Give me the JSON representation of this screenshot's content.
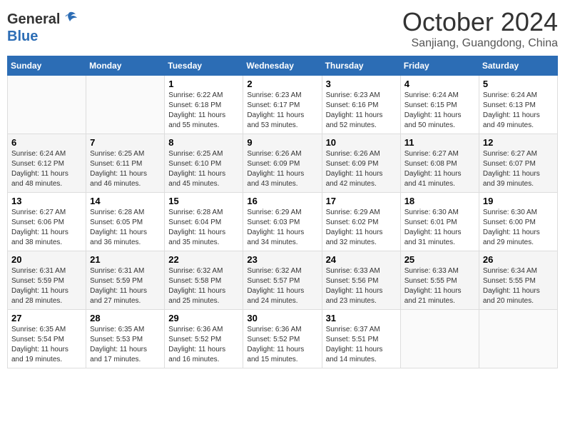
{
  "header": {
    "logo_general": "General",
    "logo_blue": "Blue",
    "month": "October 2024",
    "location": "Sanjiang, Guangdong, China"
  },
  "weekdays": [
    "Sunday",
    "Monday",
    "Tuesday",
    "Wednesday",
    "Thursday",
    "Friday",
    "Saturday"
  ],
  "weeks": [
    [
      {
        "day": "",
        "sunrise": "",
        "sunset": "",
        "daylight": ""
      },
      {
        "day": "",
        "sunrise": "",
        "sunset": "",
        "daylight": ""
      },
      {
        "day": "1",
        "sunrise": "Sunrise: 6:22 AM",
        "sunset": "Sunset: 6:18 PM",
        "daylight": "Daylight: 11 hours and 55 minutes."
      },
      {
        "day": "2",
        "sunrise": "Sunrise: 6:23 AM",
        "sunset": "Sunset: 6:17 PM",
        "daylight": "Daylight: 11 hours and 53 minutes."
      },
      {
        "day": "3",
        "sunrise": "Sunrise: 6:23 AM",
        "sunset": "Sunset: 6:16 PM",
        "daylight": "Daylight: 11 hours and 52 minutes."
      },
      {
        "day": "4",
        "sunrise": "Sunrise: 6:24 AM",
        "sunset": "Sunset: 6:15 PM",
        "daylight": "Daylight: 11 hours and 50 minutes."
      },
      {
        "day": "5",
        "sunrise": "Sunrise: 6:24 AM",
        "sunset": "Sunset: 6:13 PM",
        "daylight": "Daylight: 11 hours and 49 minutes."
      }
    ],
    [
      {
        "day": "6",
        "sunrise": "Sunrise: 6:24 AM",
        "sunset": "Sunset: 6:12 PM",
        "daylight": "Daylight: 11 hours and 48 minutes."
      },
      {
        "day": "7",
        "sunrise": "Sunrise: 6:25 AM",
        "sunset": "Sunset: 6:11 PM",
        "daylight": "Daylight: 11 hours and 46 minutes."
      },
      {
        "day": "8",
        "sunrise": "Sunrise: 6:25 AM",
        "sunset": "Sunset: 6:10 PM",
        "daylight": "Daylight: 11 hours and 45 minutes."
      },
      {
        "day": "9",
        "sunrise": "Sunrise: 6:26 AM",
        "sunset": "Sunset: 6:09 PM",
        "daylight": "Daylight: 11 hours and 43 minutes."
      },
      {
        "day": "10",
        "sunrise": "Sunrise: 6:26 AM",
        "sunset": "Sunset: 6:09 PM",
        "daylight": "Daylight: 11 hours and 42 minutes."
      },
      {
        "day": "11",
        "sunrise": "Sunrise: 6:27 AM",
        "sunset": "Sunset: 6:08 PM",
        "daylight": "Daylight: 11 hours and 41 minutes."
      },
      {
        "day": "12",
        "sunrise": "Sunrise: 6:27 AM",
        "sunset": "Sunset: 6:07 PM",
        "daylight": "Daylight: 11 hours and 39 minutes."
      }
    ],
    [
      {
        "day": "13",
        "sunrise": "Sunrise: 6:27 AM",
        "sunset": "Sunset: 6:06 PM",
        "daylight": "Daylight: 11 hours and 38 minutes."
      },
      {
        "day": "14",
        "sunrise": "Sunrise: 6:28 AM",
        "sunset": "Sunset: 6:05 PM",
        "daylight": "Daylight: 11 hours and 36 minutes."
      },
      {
        "day": "15",
        "sunrise": "Sunrise: 6:28 AM",
        "sunset": "Sunset: 6:04 PM",
        "daylight": "Daylight: 11 hours and 35 minutes."
      },
      {
        "day": "16",
        "sunrise": "Sunrise: 6:29 AM",
        "sunset": "Sunset: 6:03 PM",
        "daylight": "Daylight: 11 hours and 34 minutes."
      },
      {
        "day": "17",
        "sunrise": "Sunrise: 6:29 AM",
        "sunset": "Sunset: 6:02 PM",
        "daylight": "Daylight: 11 hours and 32 minutes."
      },
      {
        "day": "18",
        "sunrise": "Sunrise: 6:30 AM",
        "sunset": "Sunset: 6:01 PM",
        "daylight": "Daylight: 11 hours and 31 minutes."
      },
      {
        "day": "19",
        "sunrise": "Sunrise: 6:30 AM",
        "sunset": "Sunset: 6:00 PM",
        "daylight": "Daylight: 11 hours and 29 minutes."
      }
    ],
    [
      {
        "day": "20",
        "sunrise": "Sunrise: 6:31 AM",
        "sunset": "Sunset: 5:59 PM",
        "daylight": "Daylight: 11 hours and 28 minutes."
      },
      {
        "day": "21",
        "sunrise": "Sunrise: 6:31 AM",
        "sunset": "Sunset: 5:59 PM",
        "daylight": "Daylight: 11 hours and 27 minutes."
      },
      {
        "day": "22",
        "sunrise": "Sunrise: 6:32 AM",
        "sunset": "Sunset: 5:58 PM",
        "daylight": "Daylight: 11 hours and 25 minutes."
      },
      {
        "day": "23",
        "sunrise": "Sunrise: 6:32 AM",
        "sunset": "Sunset: 5:57 PM",
        "daylight": "Daylight: 11 hours and 24 minutes."
      },
      {
        "day": "24",
        "sunrise": "Sunrise: 6:33 AM",
        "sunset": "Sunset: 5:56 PM",
        "daylight": "Daylight: 11 hours and 23 minutes."
      },
      {
        "day": "25",
        "sunrise": "Sunrise: 6:33 AM",
        "sunset": "Sunset: 5:55 PM",
        "daylight": "Daylight: 11 hours and 21 minutes."
      },
      {
        "day": "26",
        "sunrise": "Sunrise: 6:34 AM",
        "sunset": "Sunset: 5:55 PM",
        "daylight": "Daylight: 11 hours and 20 minutes."
      }
    ],
    [
      {
        "day": "27",
        "sunrise": "Sunrise: 6:35 AM",
        "sunset": "Sunset: 5:54 PM",
        "daylight": "Daylight: 11 hours and 19 minutes."
      },
      {
        "day": "28",
        "sunrise": "Sunrise: 6:35 AM",
        "sunset": "Sunset: 5:53 PM",
        "daylight": "Daylight: 11 hours and 17 minutes."
      },
      {
        "day": "29",
        "sunrise": "Sunrise: 6:36 AM",
        "sunset": "Sunset: 5:52 PM",
        "daylight": "Daylight: 11 hours and 16 minutes."
      },
      {
        "day": "30",
        "sunrise": "Sunrise: 6:36 AM",
        "sunset": "Sunset: 5:52 PM",
        "daylight": "Daylight: 11 hours and 15 minutes."
      },
      {
        "day": "31",
        "sunrise": "Sunrise: 6:37 AM",
        "sunset": "Sunset: 5:51 PM",
        "daylight": "Daylight: 11 hours and 14 minutes."
      },
      {
        "day": "",
        "sunrise": "",
        "sunset": "",
        "daylight": ""
      },
      {
        "day": "",
        "sunrise": "",
        "sunset": "",
        "daylight": ""
      }
    ]
  ]
}
